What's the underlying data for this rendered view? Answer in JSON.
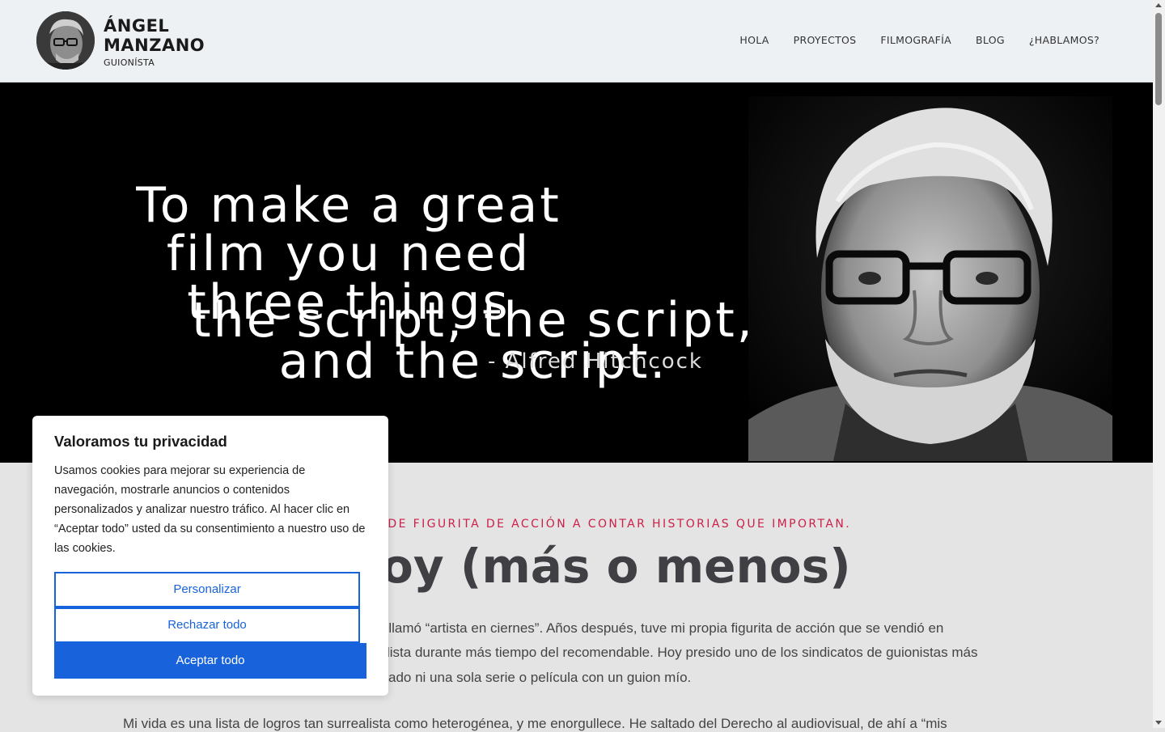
{
  "header": {
    "brand_line1": "ÁNGEL",
    "brand_line2": "MANZANO",
    "brand_sub": "GUIONÍSTA",
    "nav": [
      "HOLA",
      "PROYECTOS",
      "FILMOGRAFÍA",
      "BLOG",
      "¿HABLAMOS?"
    ]
  },
  "hero": {
    "quote_lines": [
      "To make a great",
      "film you need",
      "three things",
      "the script, the script,",
      "and the script."
    ],
    "attribution": "- Alfred Hitchcock"
  },
  "about": {
    "tagline": "ONISTA. DE FIGURITA DE ACCIÓN A CONTAR HISTORIAS QUE IMPORTAN.",
    "title": "n soy (más o menos)",
    "paragraph_lines": [
      "me llamó “artista en ciernes”. Años después, tuve mi propia figurita de acción que se vendió en",
      "lista durante más tiempo del recomendable. Hoy presido uno de los sindicatos de guionistas más",
      "ado ni una sola serie o película con un guion mío."
    ],
    "paragraph2": "Mi vida es una lista de logros tan surrealista como heterogénea, y me enorgullece. He saltado del Derecho al audiovisual, de ahí a “mis"
  },
  "cookie": {
    "title": "Valoramos tu privacidad",
    "text": "Usamos cookies para mejorar su experiencia de navegación, mostrarle anuncios o contenidos personalizados y analizar nuestro tráfico. Al hacer clic en “Aceptar todo” usted da su consentimiento a nuestro uso de las cookies.",
    "customize": "Personalizar",
    "reject": "Rechazar todo",
    "accept": "Aceptar todo"
  },
  "colors": {
    "accent": "#cc2048",
    "cookie_button": "#1863dc",
    "header_bg": "#eef1f4",
    "hero_bg": "#000000",
    "content_bg": "#e4e4e4"
  }
}
